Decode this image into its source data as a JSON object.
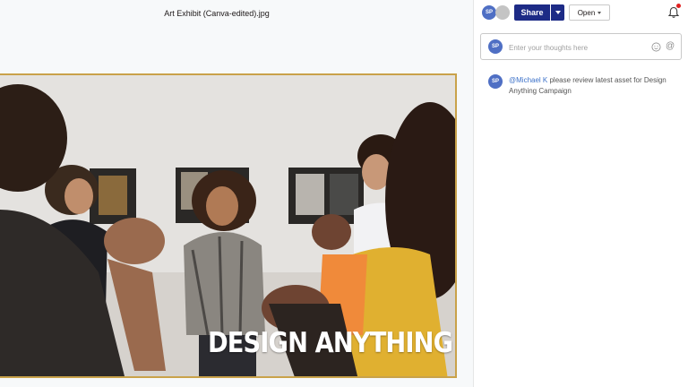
{
  "file": {
    "title": "Art Exhibit (Canva-edited).jpg"
  },
  "image": {
    "headline": "DESIGN ANYTHING",
    "frame_color": "#c9a24a"
  },
  "header": {
    "avatar_initials": "SP",
    "share_label": "Share",
    "open_label": "Open",
    "brand_color": "#1d2b86",
    "avatar_color": "#4f6fc4",
    "notification_dot_color": "#e02020"
  },
  "composer": {
    "avatar_initials": "SP",
    "placeholder": "Enter your thoughts here",
    "value": ""
  },
  "comments": [
    {
      "avatar_initials": "SP",
      "mention": "@Michael K",
      "text": " please review latest asset for Design Anything Campaign",
      "mention_color": "#3d72c9"
    }
  ]
}
